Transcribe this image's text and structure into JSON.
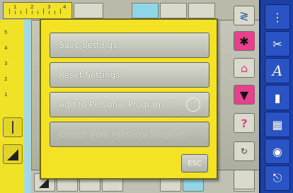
{
  "menu": {
    "save_settings": "Save Settings",
    "reset_settings": "Reset Settings",
    "add_personal": "Add to Personal Program",
    "disabled_item": "Delete from Personal Program",
    "esc": "ESC"
  },
  "ruler": {
    "labels": [
      "1",
      "2",
      "3",
      "4"
    ]
  },
  "left": {
    "labels": [
      "5",
      "4",
      "3",
      "2",
      "1"
    ]
  },
  "colors": {
    "popup": "#f4e324",
    "blue_panel": "#1b3fa3",
    "accent_pink": "#e7418e",
    "strip_cyan": "#9fd9ea"
  },
  "icons": {
    "sidebar": [
      "stitch-icon",
      "needle-thread-icon",
      "alphabet-icon",
      "buttonhole-icon",
      "quilt-icon",
      "memory-icon",
      "setup-icon"
    ],
    "midcol": [
      "zigzag-icon",
      "needle-down-icon",
      "stitch-up-icon",
      "arrow-down-icon",
      "help-icon",
      "clr-icon"
    ]
  }
}
